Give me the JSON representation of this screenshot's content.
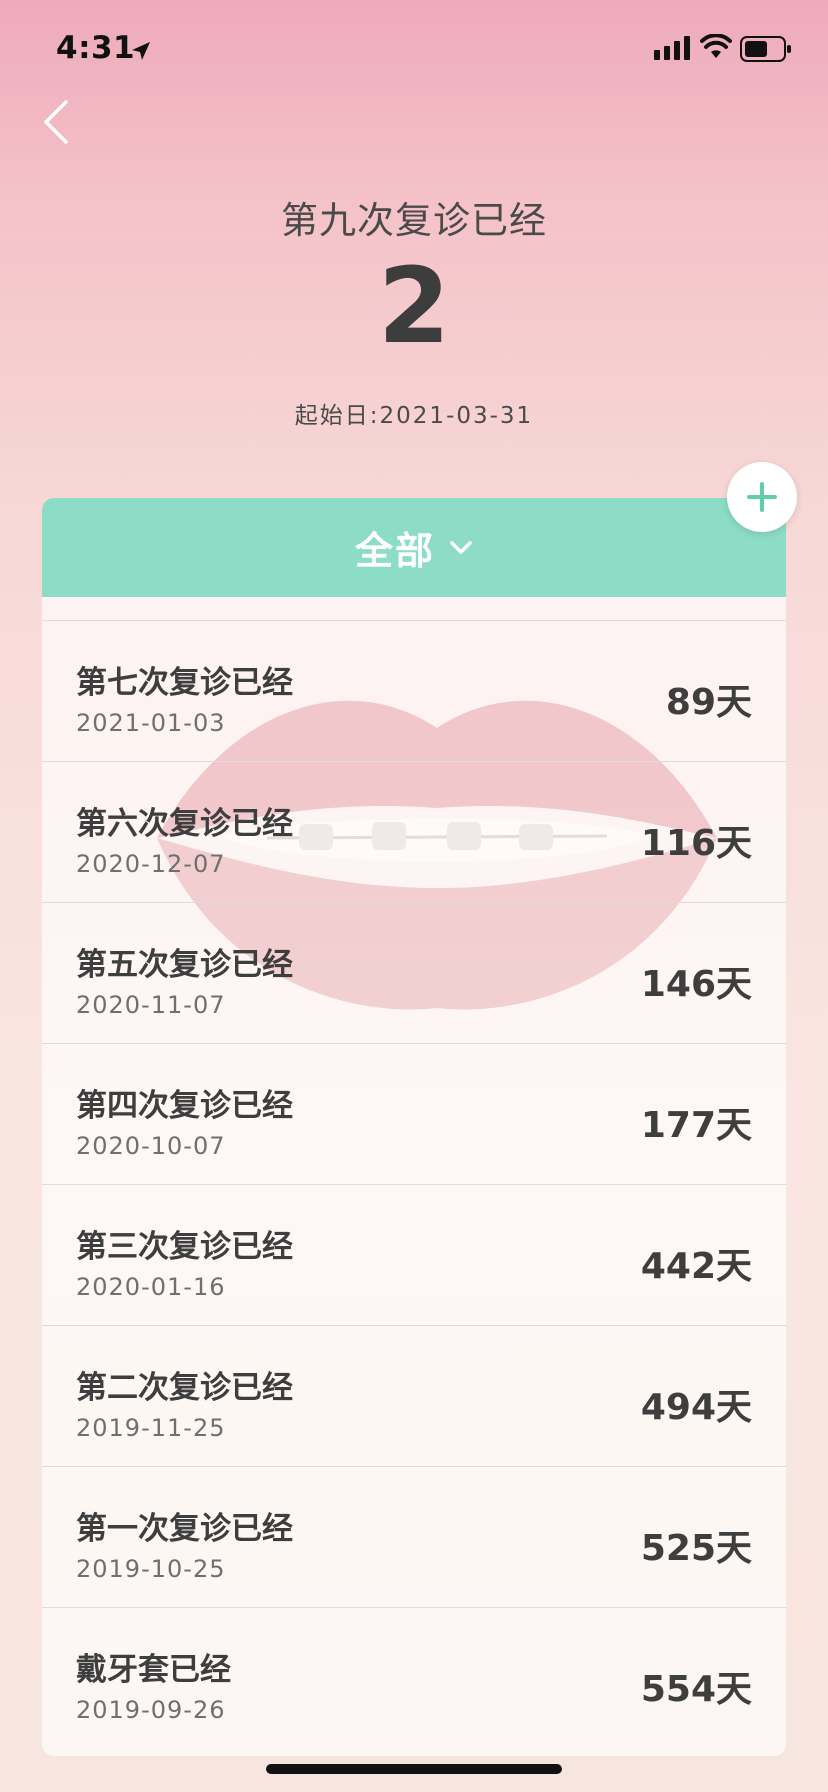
{
  "status_bar": {
    "time": "4:31"
  },
  "header": {
    "title": "第九次复诊已经",
    "count": "2",
    "start_date": "起始日:2021-03-31"
  },
  "filter": {
    "label": "全部"
  },
  "records": [
    {
      "title": "第七次复诊已经",
      "date": "2021-01-03",
      "days": "89天"
    },
    {
      "title": "第六次复诊已经",
      "date": "2020-12-07",
      "days": "116天"
    },
    {
      "title": "第五次复诊已经",
      "date": "2020-11-07",
      "days": "146天"
    },
    {
      "title": "第四次复诊已经",
      "date": "2020-10-07",
      "days": "177天"
    },
    {
      "title": "第三次复诊已经",
      "date": "2020-01-16",
      "days": "442天"
    },
    {
      "title": "第二次复诊已经",
      "date": "2019-11-25",
      "days": "494天"
    },
    {
      "title": "第一次复诊已经",
      "date": "2019-10-25",
      "days": "525天"
    },
    {
      "title": "戴牙套已经",
      "date": "2019-09-26",
      "days": "554天"
    }
  ],
  "colors": {
    "accent": "#8ddcc5",
    "plus": "#5fcfa8",
    "text": "#3e3e3e"
  },
  "icons": {
    "back": "chevron-left-icon",
    "add": "plus-icon",
    "filter": "chevron-down-icon",
    "location": "location-arrow-icon",
    "signal": "cellular-signal-icon",
    "wifi": "wifi-icon",
    "battery": "battery-icon"
  }
}
